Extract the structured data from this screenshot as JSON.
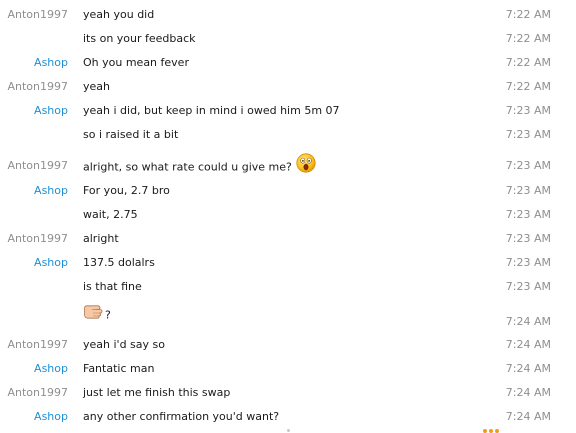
{
  "messages": [
    {
      "sender": "Anton1997",
      "text": "yeah you did",
      "time": "7:22 AM"
    },
    {
      "sender": "",
      "text": "its on your feedback",
      "time": "7:22 AM"
    },
    {
      "sender": "Ashop",
      "text": "Oh you mean fever",
      "time": "7:22 AM"
    },
    {
      "sender": "Anton1997",
      "text": "yeah",
      "time": "7:22 AM"
    },
    {
      "sender": "Ashop",
      "text": "yeah i did, but keep in mind i owed him 5m 07",
      "time": "7:23 AM"
    },
    {
      "sender": "",
      "text": "so i raised it a bit",
      "time": "7:23 AM"
    },
    {
      "sender": "Anton1997",
      "text": "alright, so what rate could u give me?",
      "time": "7:23 AM",
      "emoji": "shocked-face"
    },
    {
      "sender": "Ashop",
      "text": "For you, 2.7 bro",
      "time": "7:23 AM"
    },
    {
      "sender": "",
      "text": "wait, 2.75",
      "time": "7:23 AM"
    },
    {
      "sender": "Anton1997",
      "text": "alright",
      "time": "7:23 AM"
    },
    {
      "sender": "Ashop",
      "text": "137.5 dolalrs",
      "time": "7:23 AM"
    },
    {
      "sender": "",
      "text": "is that fine",
      "time": "7:23 AM"
    },
    {
      "sender": "",
      "text": "?",
      "time": "7:24 AM",
      "emoji": "pointing-hand"
    },
    {
      "sender": "Anton1997",
      "text": "yeah i'd say so",
      "time": "7:24 AM"
    },
    {
      "sender": "Ashop",
      "text": "Fantatic man",
      "time": "7:24 AM"
    },
    {
      "sender": "Anton1997",
      "text": "just let me finish this swap",
      "time": "7:24 AM"
    },
    {
      "sender": "Ashop",
      "text": "any other confirmation you'd want?",
      "time": "7:24 AM"
    }
  ],
  "colors": {
    "anton": "#8f8f8f",
    "ashop": "#1e8fd6",
    "time": "#8f8f8f",
    "accent": "#f39a1f"
  }
}
